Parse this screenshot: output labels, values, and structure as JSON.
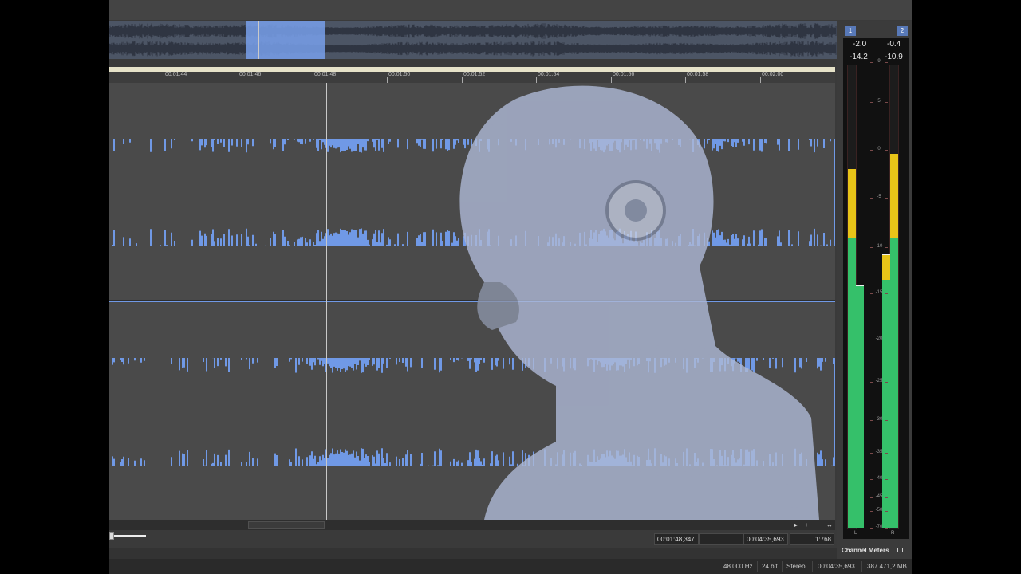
{
  "ruler": {
    "ticks": [
      "00:01:44",
      "00:01:46",
      "00:01:48",
      "00:01:50",
      "00:01:52",
      "00:01:54",
      "00:01:56",
      "00:01:58",
      "00:02:00"
    ]
  },
  "nav": {
    "play_icon": "▸",
    "zoom_in_icon": "+",
    "zoom_out_icon": "−",
    "fit_icon": "↔"
  },
  "selection": {
    "start": "00:01:48,347",
    "end": "",
    "length": "00:04:35,693",
    "zoom": "1:768"
  },
  "meters": {
    "channel_1": "1",
    "channel_2": "2",
    "left": {
      "peak": "-2.0",
      "rms": "-14.2",
      "letter": "L"
    },
    "right": {
      "peak": "-0.4",
      "rms": "-10.9",
      "letter": "R"
    },
    "scale": [
      "9",
      "5",
      "0",
      "-5",
      "-10",
      "-15",
      "-20",
      "-25",
      "-30",
      "-35",
      "-40",
      "-45",
      "-50",
      "-70"
    ],
    "title": "Channel Meters"
  },
  "status": {
    "sample_rate": "48.000 Hz",
    "bit_depth": "24 bit",
    "channels": "Stereo",
    "duration": "00:04:35,693",
    "free_space": "387.471,2 MB"
  },
  "colors": {
    "waveform_bg": "#7099e6",
    "waveform_fg": "#4a4a4a",
    "meter_green": "#35c06a",
    "meter_yellow": "#e8c418"
  }
}
